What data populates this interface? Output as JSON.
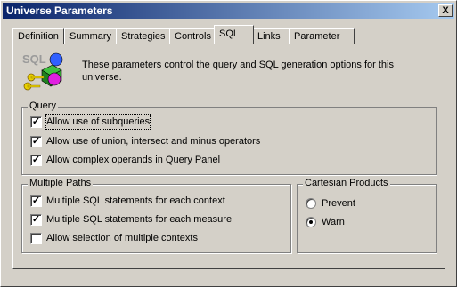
{
  "window": {
    "title": "Universe Parameters",
    "close_label": "X"
  },
  "tabs": [
    {
      "label": "Definition"
    },
    {
      "label": "Summary"
    },
    {
      "label": "Strategies"
    },
    {
      "label": "Controls"
    },
    {
      "label": "SQL"
    },
    {
      "label": "Links"
    },
    {
      "label": "Parameter"
    }
  ],
  "active_tab": "SQL",
  "description": "These parameters control the query and SQL generation options for this universe.",
  "icon_label": "SQL",
  "query_group": {
    "legend": "Query",
    "items": [
      {
        "label": "Allow use of subqueries",
        "checked": true
      },
      {
        "label": "Allow use of union, intersect and minus operators",
        "checked": true
      },
      {
        "label": "Allow complex operands in Query Panel",
        "checked": true
      }
    ]
  },
  "multiple_paths_group": {
    "legend": "Multiple Paths",
    "items": [
      {
        "label": "Multiple SQL statements for each context",
        "checked": true
      },
      {
        "label": "Multiple SQL statements for each measure",
        "checked": true
      },
      {
        "label": "Allow selection of multiple contexts",
        "checked": false
      }
    ]
  },
  "cartesian_group": {
    "legend": "Cartesian Products",
    "options": [
      {
        "label": "Prevent",
        "selected": false
      },
      {
        "label": "Warn",
        "selected": true
      }
    ]
  },
  "check_mark": "✓"
}
